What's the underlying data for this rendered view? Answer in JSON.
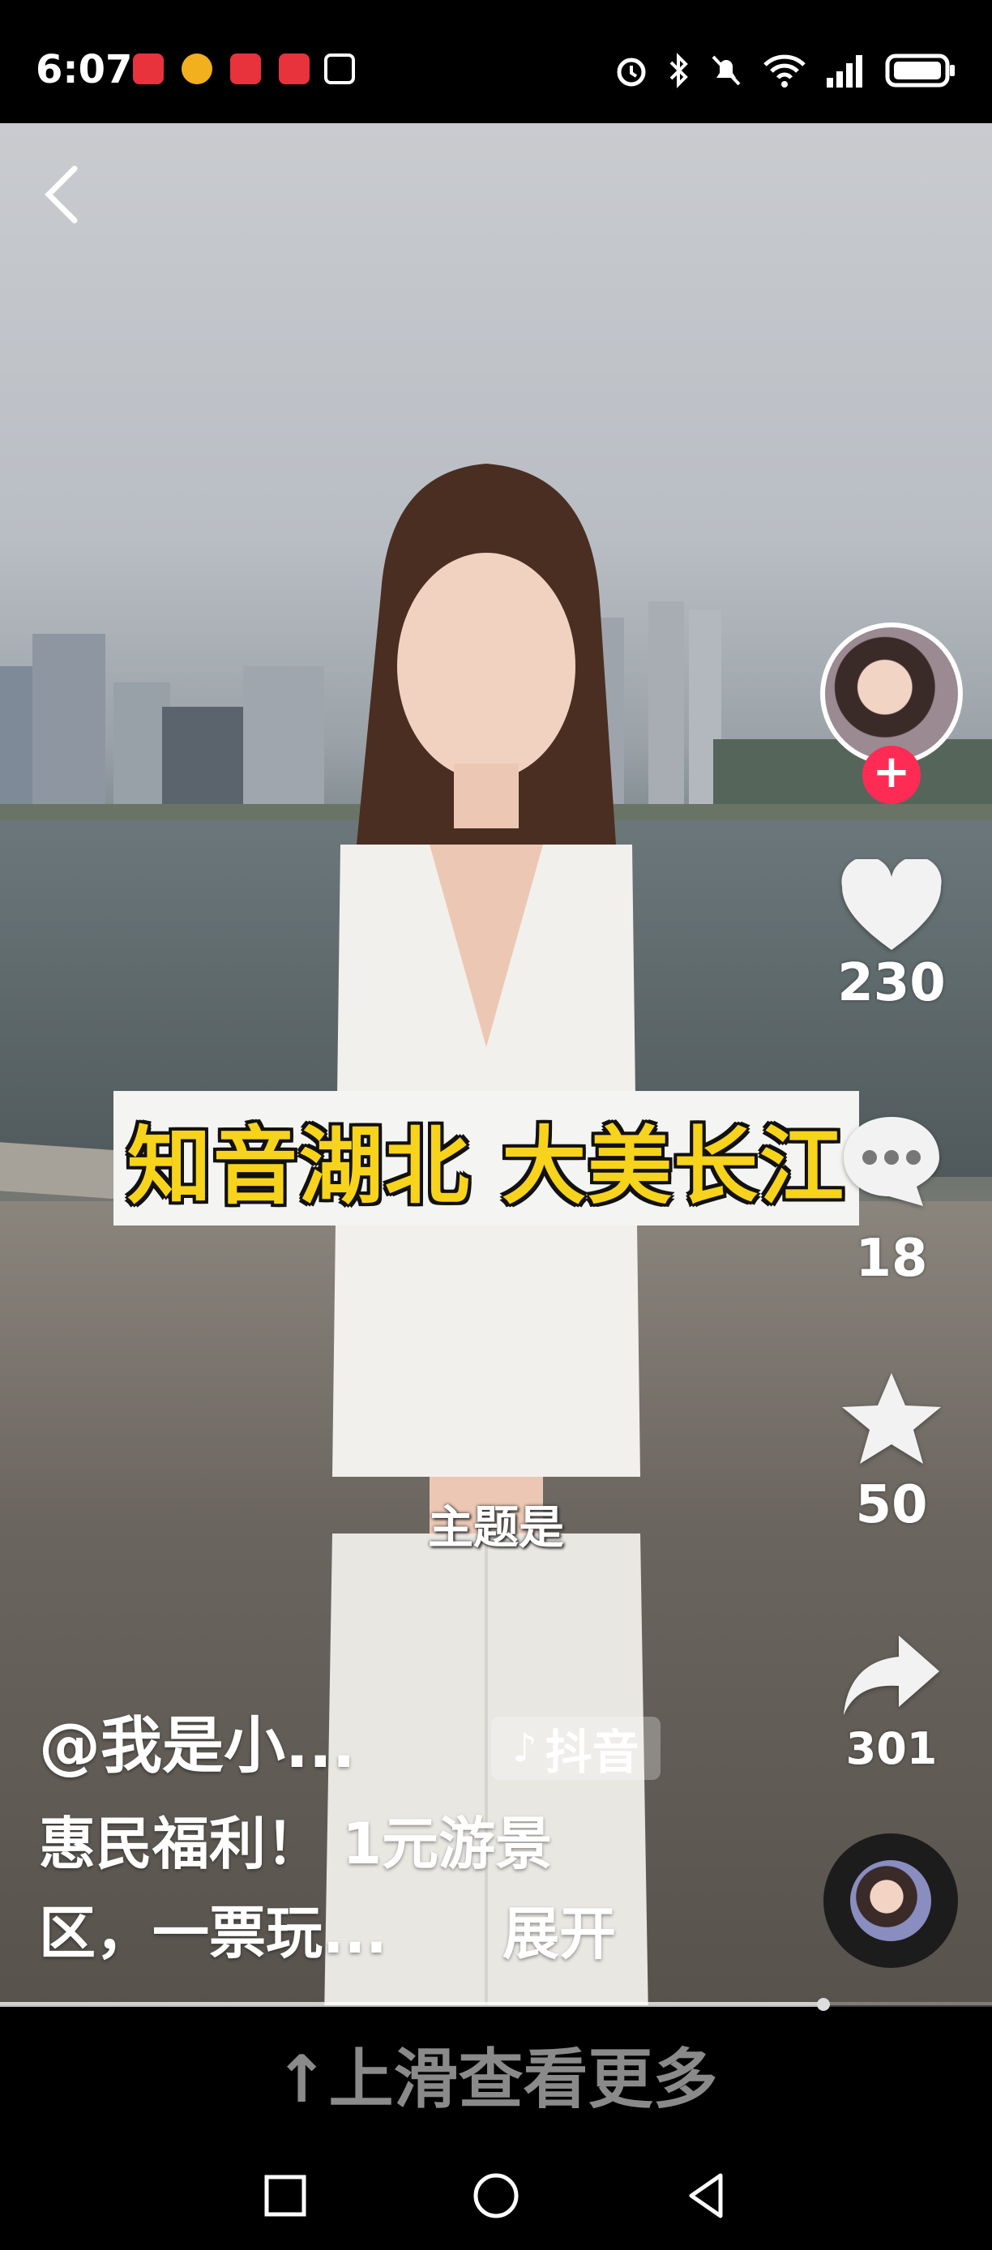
{
  "status_bar": {
    "time": "6:07"
  },
  "video": {
    "caption_banner": "知音湖北 大美长江",
    "subtitle": "主题是",
    "progress_fraction": 0.83
  },
  "actions": {
    "like_count": "230",
    "comment_count": "18",
    "favorite_count": "50",
    "share_count": "301"
  },
  "post": {
    "author": "@我是小...",
    "platform_badge": "抖音",
    "description": "惠民福利！ 1元游景区，一票玩...",
    "expand_label": "展开"
  },
  "swipe_hint": "↑上滑查看更多",
  "colors": {
    "follow_accent": "#fe2c55",
    "caption_yellow": "#f7d31c"
  }
}
